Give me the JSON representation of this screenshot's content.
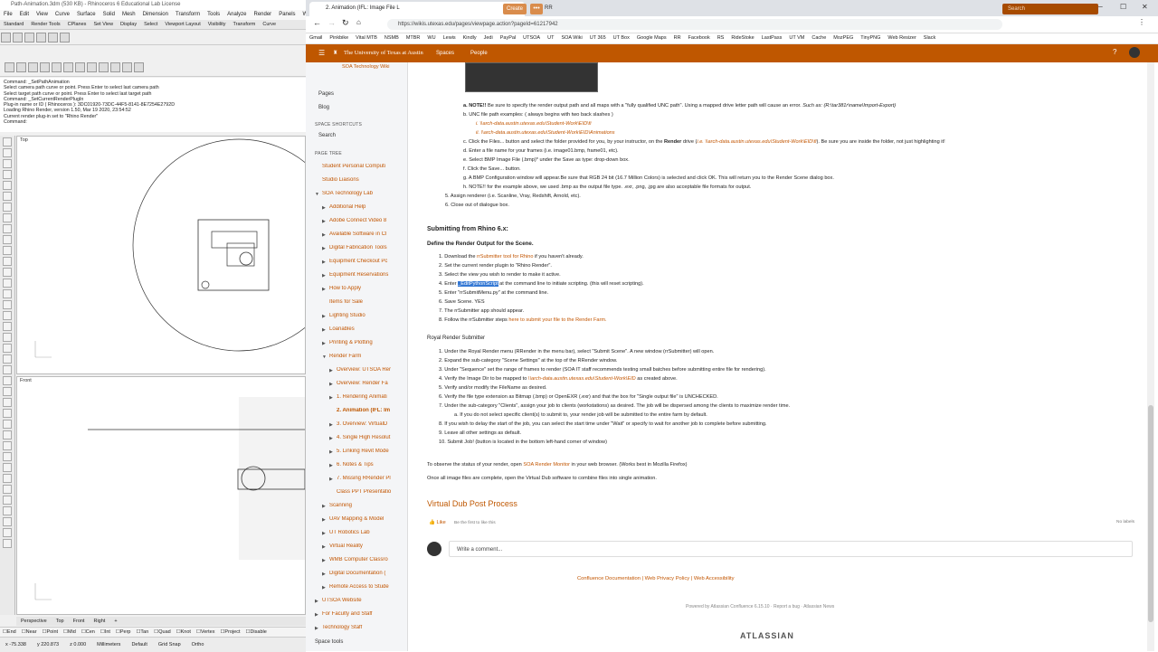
{
  "rhino": {
    "title": "Path-Animation.3dm (530 KB) - Rhinoceros 6 Educational Lab License",
    "menu": [
      "File",
      "Edit",
      "View",
      "Curve",
      "Surface",
      "Solid",
      "Mesh",
      "Dimension",
      "Transform",
      "Tools",
      "Analyze",
      "Render",
      "Panels",
      "Windows"
    ],
    "tabs": [
      "Standard",
      "Render Tools",
      "CPlanes",
      "Set View",
      "Display",
      "Select",
      "Viewport Layout",
      "Visibility",
      "Transform",
      "Curve"
    ],
    "command_lines": [
      "Command: _SetPathAnimation",
      "Select camera path curve or point. Press Enter to select last camera path",
      "Select target path curve or point. Press Enter to select last target path",
      "Command: _SetCurrentRenderPlugIn",
      "Plug-in name or ID ( Rhinoceros ): 3DC01920-73DC-44F5-8141-8E7254E2792D",
      "Loading Rhino Render, version 1.50, Mar 19 2020, 23:54:52",
      "Current render plug-in set to \"Rhino Render\"",
      "Command:"
    ],
    "viewport_top": "Top",
    "viewport_front": "Front",
    "viewport_tabs": [
      "Perspective",
      "Top",
      "Front",
      "Right",
      "+"
    ],
    "osnaps": [
      "End",
      "Near",
      "Point",
      "Mid",
      "Cen",
      "Int",
      "Perp",
      "Tan",
      "Quad",
      "Knot",
      "Vertex",
      "Project",
      "Disable"
    ],
    "status": [
      "x -75.338",
      "y 220.873",
      "z 0.000",
      "Millimeters",
      "Default",
      "Grid Snap",
      "Ortho"
    ]
  },
  "browser": {
    "tab1_title": "2. Animation (IFL: Image File L",
    "tab2_title": "RR",
    "url": "https://wikis.utexas.edu/pages/viewpage.action?pageId=61217942",
    "bookmarks": [
      "Gmail",
      "Pinkbike",
      "Vital MTB",
      "NSMB",
      "MTBR",
      "WU",
      "Lewis",
      "Kindly",
      "Jedi",
      "PayPal",
      "UTSOA",
      "UT",
      "SOA Wiki",
      "UT 365",
      "UT Box",
      "Google Maps",
      "RR",
      "Facebook",
      "RS",
      "RideStoke",
      "LastPass",
      "UT VM",
      "Cache",
      "MozPEG",
      "TinyPNG",
      "Web Resizer",
      "Slack"
    ]
  },
  "confluence": {
    "brand": "The University of Texas at Austin",
    "nav": [
      "Spaces",
      "People"
    ],
    "create": "Create",
    "more": "•••",
    "search_placeholder": "Search",
    "sidebar": {
      "space_name": "SOA Technology Wiki",
      "pages": "Pages",
      "blog": "Blog",
      "shortcuts_head": "SPACE SHORTCUTS",
      "search": "Search",
      "tree_head": "PAGE TREE",
      "tree": [
        {
          "label": "Student Personal Computi",
          "indent": 0,
          "arrow": ""
        },
        {
          "label": "Studio Liaisons",
          "indent": 0,
          "arrow": ""
        },
        {
          "label": "SOA Technology Lab",
          "indent": 0,
          "arrow": "▼"
        },
        {
          "label": "Additional Help",
          "indent": 1,
          "arrow": "▶"
        },
        {
          "label": "Adobe Connect Video 8",
          "indent": 1,
          "arrow": "▶"
        },
        {
          "label": "Available Software in Cl",
          "indent": 1,
          "arrow": "▶"
        },
        {
          "label": "Digital Fabrication Tools",
          "indent": 1,
          "arrow": "▶"
        },
        {
          "label": "Equipment Checkout Pc",
          "indent": 1,
          "arrow": "▶"
        },
        {
          "label": "Equipment Reservations",
          "indent": 1,
          "arrow": "▶"
        },
        {
          "label": "How to Apply",
          "indent": 1,
          "arrow": "▶"
        },
        {
          "label": "Items for Sale",
          "indent": 1,
          "arrow": ""
        },
        {
          "label": "Lighting Studio",
          "indent": 1,
          "arrow": "▶"
        },
        {
          "label": "Loanables",
          "indent": 1,
          "arrow": "▶"
        },
        {
          "label": "Printing & Plotting",
          "indent": 1,
          "arrow": "▶"
        },
        {
          "label": "Render Farm",
          "indent": 1,
          "arrow": "▼"
        },
        {
          "label": "Overview: UTSOA Rer",
          "indent": 2,
          "arrow": "▶"
        },
        {
          "label": "Overview: Render Fa",
          "indent": 2,
          "arrow": "▶"
        },
        {
          "label": "1. Rendering Animati",
          "indent": 2,
          "arrow": "▶"
        },
        {
          "label": "2. Animation (IFL: Im",
          "indent": 2,
          "arrow": "",
          "current": true
        },
        {
          "label": "3. Overview: VirtualD",
          "indent": 2,
          "arrow": "▶"
        },
        {
          "label": "4. Single High Resolut",
          "indent": 2,
          "arrow": "▶"
        },
        {
          "label": "5. Linking Revit Mode",
          "indent": 2,
          "arrow": "▶"
        },
        {
          "label": "6. Notes & Tips",
          "indent": 2,
          "arrow": "▶"
        },
        {
          "label": "7. Missing RRender Pl",
          "indent": 2,
          "arrow": "▶"
        },
        {
          "label": "Class PPT Presentatio",
          "indent": 2,
          "arrow": ""
        },
        {
          "label": "Scanning",
          "indent": 1,
          "arrow": "▶"
        },
        {
          "label": "UAV Mapping & Model",
          "indent": 1,
          "arrow": "▶"
        },
        {
          "label": "UT Robotics Lab",
          "indent": 1,
          "arrow": "▶"
        },
        {
          "label": "Virtual Reality",
          "indent": 1,
          "arrow": "▶"
        },
        {
          "label": "WMB Computer Classro",
          "indent": 1,
          "arrow": "▶"
        },
        {
          "label": "Digital Documentation (",
          "indent": 1,
          "arrow": "▶"
        },
        {
          "label": "Remote Access to Stude",
          "indent": 1,
          "arrow": "▶"
        },
        {
          "label": "UTSOA Website",
          "indent": 0,
          "arrow": "▶"
        },
        {
          "label": "For Faculty and Staff",
          "indent": 0,
          "arrow": "▶"
        },
        {
          "label": "Technology Staff",
          "indent": 0,
          "arrow": "▶"
        }
      ],
      "space_tools": "Space tools"
    },
    "content": {
      "noteA_label": "a. NOTE!!",
      "noteA_text": " Be sure to specify the render output path and all maps with a \"fully qualified UNC path\".  Using a mapped drive letter path will cause an error. ",
      "noteA_ex": "Such as: (R:\\tar381r\\name\\Import-Export)",
      "b": "b. UNC file path examples: ( always begins with two back slashes )",
      "b1": "i. \\\\arch-data.austin.utexas.edu\\Student-Work\\EID\\fi",
      "b2": "ii. \\\\arch-data.austin.utexas.edu\\Student-Work\\EID\\Animations",
      "c1": "c. Click the Files... button and select the folder provided for you, by your instructor, on the ",
      "c_render": "Render",
      "c2": " drive (",
      "c_path": "i.e. \\\\arch-data.austin.utexas.edu\\Student-Work\\EID\\fi",
      "c3": "). Be sure you are inside the folder, not just highlighting it!",
      "d": "d. Enter a file name for your frames (i.e. image01.bmp, frame01, etc).",
      "e": "e. Select BMP Image File (.bmp)* under the Save as type: drop-down box.",
      "f": "f. Click the Save... button.",
      "g": "g. A BMP Configuration window will appear.Be sure that RGB 24 bit (16.7 Million Colors) is selected and click OK. This will return you to the Render Scene dialog box.",
      "h": "h. NOTE!! for the example above, we used .bmp as the output file type. .exr, .png, .jpg are also acceptable file formats for output.",
      "s5": "5. Assign renderer (i.e. Scanline, Vray, Redshift, Arnold, etc).",
      "s6": "6. Close out of dialogue box.",
      "h_rhino": "Submitting from Rhino 6.x:",
      "h_define": "Define the Render Output for the Scene.",
      "r1a": "1. Download the ",
      "r1link": "rrSubmitter tool for Rhino",
      "r1b": " if you haven't already.",
      "r2": "2. Set the current render plugin to \"Rhino Render\".",
      "r3": "3. Select the view you wish to render to make it active.",
      "r4a": "4. Enter ",
      "r4hl": "_EditPythonScript",
      "r4b": " at the command line to initiate scripting. (this will reset scripting).",
      "r5": "5. Enter \"rrSubmitMenu.py\" at the command line.",
      "r6": "6. Save Scene. YES",
      "r7": "7. The rrSubmitter app should appear.",
      "r8a": "8. Follow the rrSubmitter steps ",
      "r8link": "here to submit your file to the Render Farm.",
      "h_royal": "Royal Render Submitter",
      "q1": "1. Under the Royal Render menu (RRender in the menu bar), select \"Submit Scene\". A new window (rrSubmitter) will open.",
      "q2": "2. Expand the sub-category \"Scene Settings\" at the top of the RRender window.",
      "q3": "3. Under \"Sequence\" set the range of frames to render (SOA IT staff recommends testing small batches before submitting entire file for rendering).",
      "q4a": "4. Verify the Image Dir to be mapped to ",
      "q4link": "\\\\arch-data.austin.utexas.edu\\Student-Work\\EID",
      "q4b": " as created above.",
      "q5": "5. Verify and/or modify the FileName as desired.",
      "q6": "6. Verify the file type extension as Bitmap (.bmp) or OpenEXR (.exr) and that the box for \"Single output file\" is UNCHECKED.",
      "q7": "7. Under the sub-category \"Clients\", assign your job to clients (workstations) as desired. The job will be dispersed among the clients to maximize render time.",
      "q7a": "a. If you do not select specific client(s) to submit to, your render job will be submitted to the entire farm by default.",
      "q8": "8. If you wish to delay the start of the job, you can select the start time under \"Wait\" or specify to wait for another job to complete before submitting.",
      "q9": "9. Leave all other settings as default.",
      "q10": "10. Submit Job! (button is located in the bottom left-hand corner of window)",
      "obs_a": "To observe the status of your render, open ",
      "obs_link": "SOA Render Monitor",
      "obs_b": " in your web browser.  (Works best in Mozilla Firefox)",
      "once": "Once all image files are complete, open the Virtual Dub software to combine files into single animation.",
      "h_vdub": "Virtual Dub Post Process",
      "like": "Like",
      "like_first": "Be the first to like this",
      "no_labels": "No labels",
      "comment": "Write a comment...",
      "footer_links": "Confluence Documentation | Web Privacy Policy | Web Accessibility",
      "powered": "Powered by Atlassian Confluence 6.15.10  ·  Report a bug  ·  Atlassian News",
      "atlassian": "ATLASSIAN"
    }
  },
  "colors": {
    "ut_orange": "#bf5700",
    "link": "#c25500",
    "highlight": "#3478d4"
  }
}
